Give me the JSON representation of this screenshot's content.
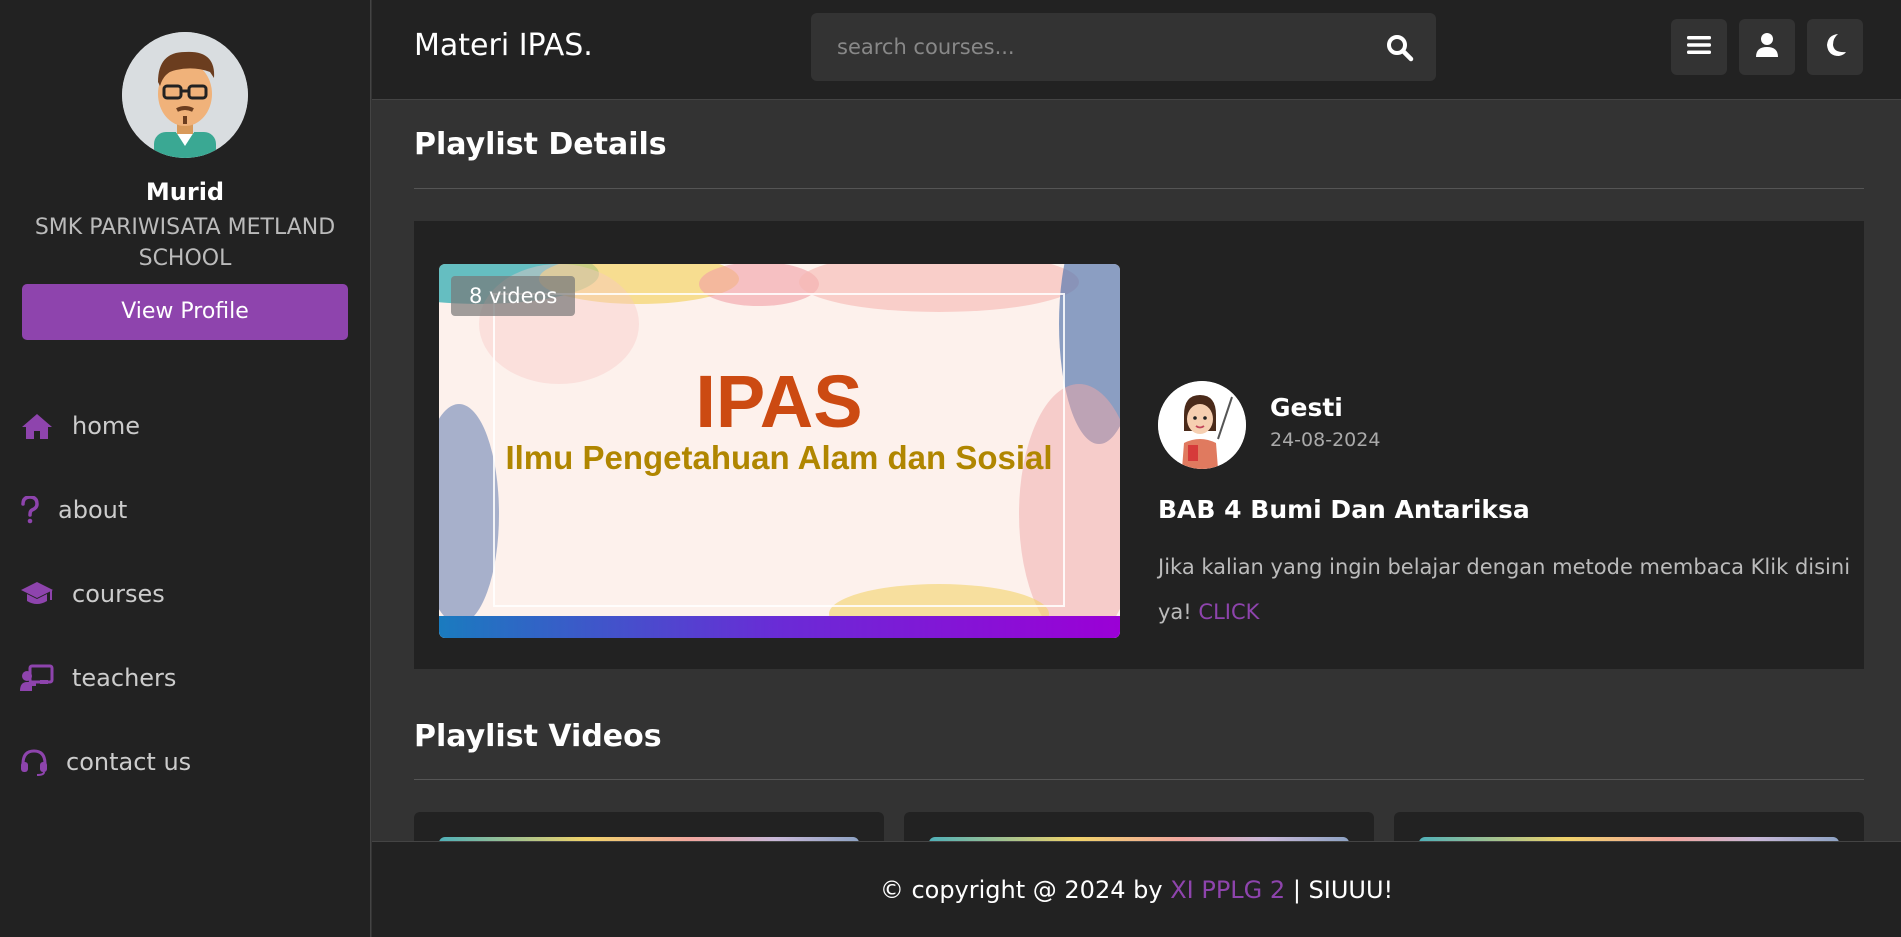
{
  "colors": {
    "accent": "#8e44ad",
    "sidebar_bg": "#222222",
    "main_bg": "#333333"
  },
  "sidebar": {
    "profile_name": "Murid",
    "profile_school": "SMK PARIWISATA METLAND SCHOOL",
    "view_profile_label": "View Profile",
    "items": [
      {
        "label": "home",
        "icon": "home-icon"
      },
      {
        "label": "about",
        "icon": "question-icon"
      },
      {
        "label": "courses",
        "icon": "graduation-cap-icon"
      },
      {
        "label": "teachers",
        "icon": "chalkboard-teacher-icon"
      },
      {
        "label": "contact us",
        "icon": "headset-icon"
      }
    ]
  },
  "header": {
    "logo": "Materi IPAS.",
    "search_placeholder": "search courses...",
    "buttons": [
      "menu-icon",
      "user-icon",
      "moon-icon"
    ]
  },
  "main": {
    "playlist_details_title": "Playlist Details",
    "thumbnail": {
      "badge": "8 videos",
      "title": "IPAS",
      "subtitle": "Ilmu Pengetahuan Alam dan Sosial"
    },
    "teacher": {
      "name": "Gesti",
      "date": "24-08-2024"
    },
    "bab_title": "BAB 4 Bumi Dan Antariksa",
    "description": "Jika kalian yang ingin belajar dengan metode membaca Klik disini ya!",
    "description_link": "CLICK",
    "playlist_videos_title": "Playlist Videos"
  },
  "footer": {
    "prefix": "© copyright @ 2024 by",
    "accent": "XI PPLG 2",
    "suffix": "| SIUUU!"
  }
}
